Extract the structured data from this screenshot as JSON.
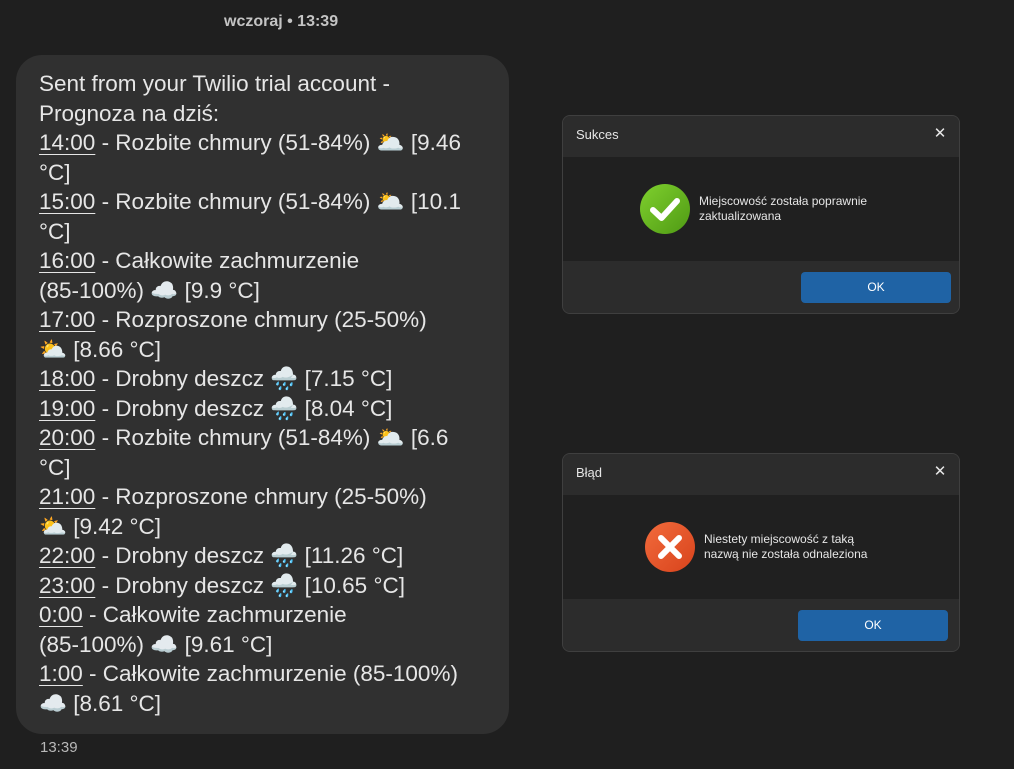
{
  "conversation": {
    "date_header": "wczoraj • 13:39",
    "message_time": "13:39",
    "message_intro": [
      "Sent from your Twilio trial account -",
      "Prognoza na dziś:"
    ],
    "forecast": [
      {
        "time": "14:00",
        "line1": " - Rozbite chmury (51-84%) 🌥️ [9.46",
        "line2": "°C]"
      },
      {
        "time": "15:00",
        "line1": " - Rozbite chmury (51-84%) 🌥️ [10.1",
        "line2": "°C]"
      },
      {
        "time": "16:00",
        "line1": " - Całkowite zachmurzenie",
        "line2": "(85-100%) ☁️ [9.9 °C]"
      },
      {
        "time": "17:00",
        "line1": " - Rozproszone chmury (25-50%)",
        "line2": "⛅ [8.66 °C]"
      },
      {
        "time": "18:00",
        "line1": " - Drobny deszcz 🌧️ [7.15 °C]",
        "line2": ""
      },
      {
        "time": "19:00",
        "line1": " - Drobny deszcz 🌧️ [8.04 °C]",
        "line2": ""
      },
      {
        "time": "20:00",
        "line1": " - Rozbite chmury (51-84%) 🌥️ [6.6",
        "line2": "°C]"
      },
      {
        "time": "21:00",
        "line1": " - Rozproszone chmury (25-50%)",
        "line2": "⛅ [9.42 °C]"
      },
      {
        "time": "22:00",
        "line1": " - Drobny deszcz 🌧️ [11.26 °C]",
        "line2": ""
      },
      {
        "time": "23:00",
        "line1": " - Drobny deszcz 🌧️ [10.65 °C]",
        "line2": ""
      },
      {
        "time": "0:00",
        "line1": " - Całkowite zachmurzenie",
        "line2": "(85-100%) ☁️ [9.61 °C]"
      },
      {
        "time": "1:00",
        "line1": " - Całkowite zachmurzenie (85-100%)",
        "line2": "☁️ [8.61 °C]"
      }
    ]
  },
  "success_dialog": {
    "title": "Sukces",
    "close_glyph": "✕",
    "message_line1": "Miejscowość została poprawnie",
    "message_line2": "zaktualizowana",
    "ok_label": "OK",
    "icon": "check-circle-icon",
    "icon_color": "#6cbb1f"
  },
  "error_dialog": {
    "title": "Błąd",
    "close_glyph": "✕",
    "message_line1": "Niestety miejscowość z taką",
    "message_line2": "nazwą nie została odnaleziona",
    "ok_label": "OK",
    "icon": "error-x-circle-icon",
    "icon_color": "#e8542a"
  },
  "colors": {
    "background": "#1f1f1f",
    "bubble": "#303030",
    "button": "#1f63a5"
  }
}
